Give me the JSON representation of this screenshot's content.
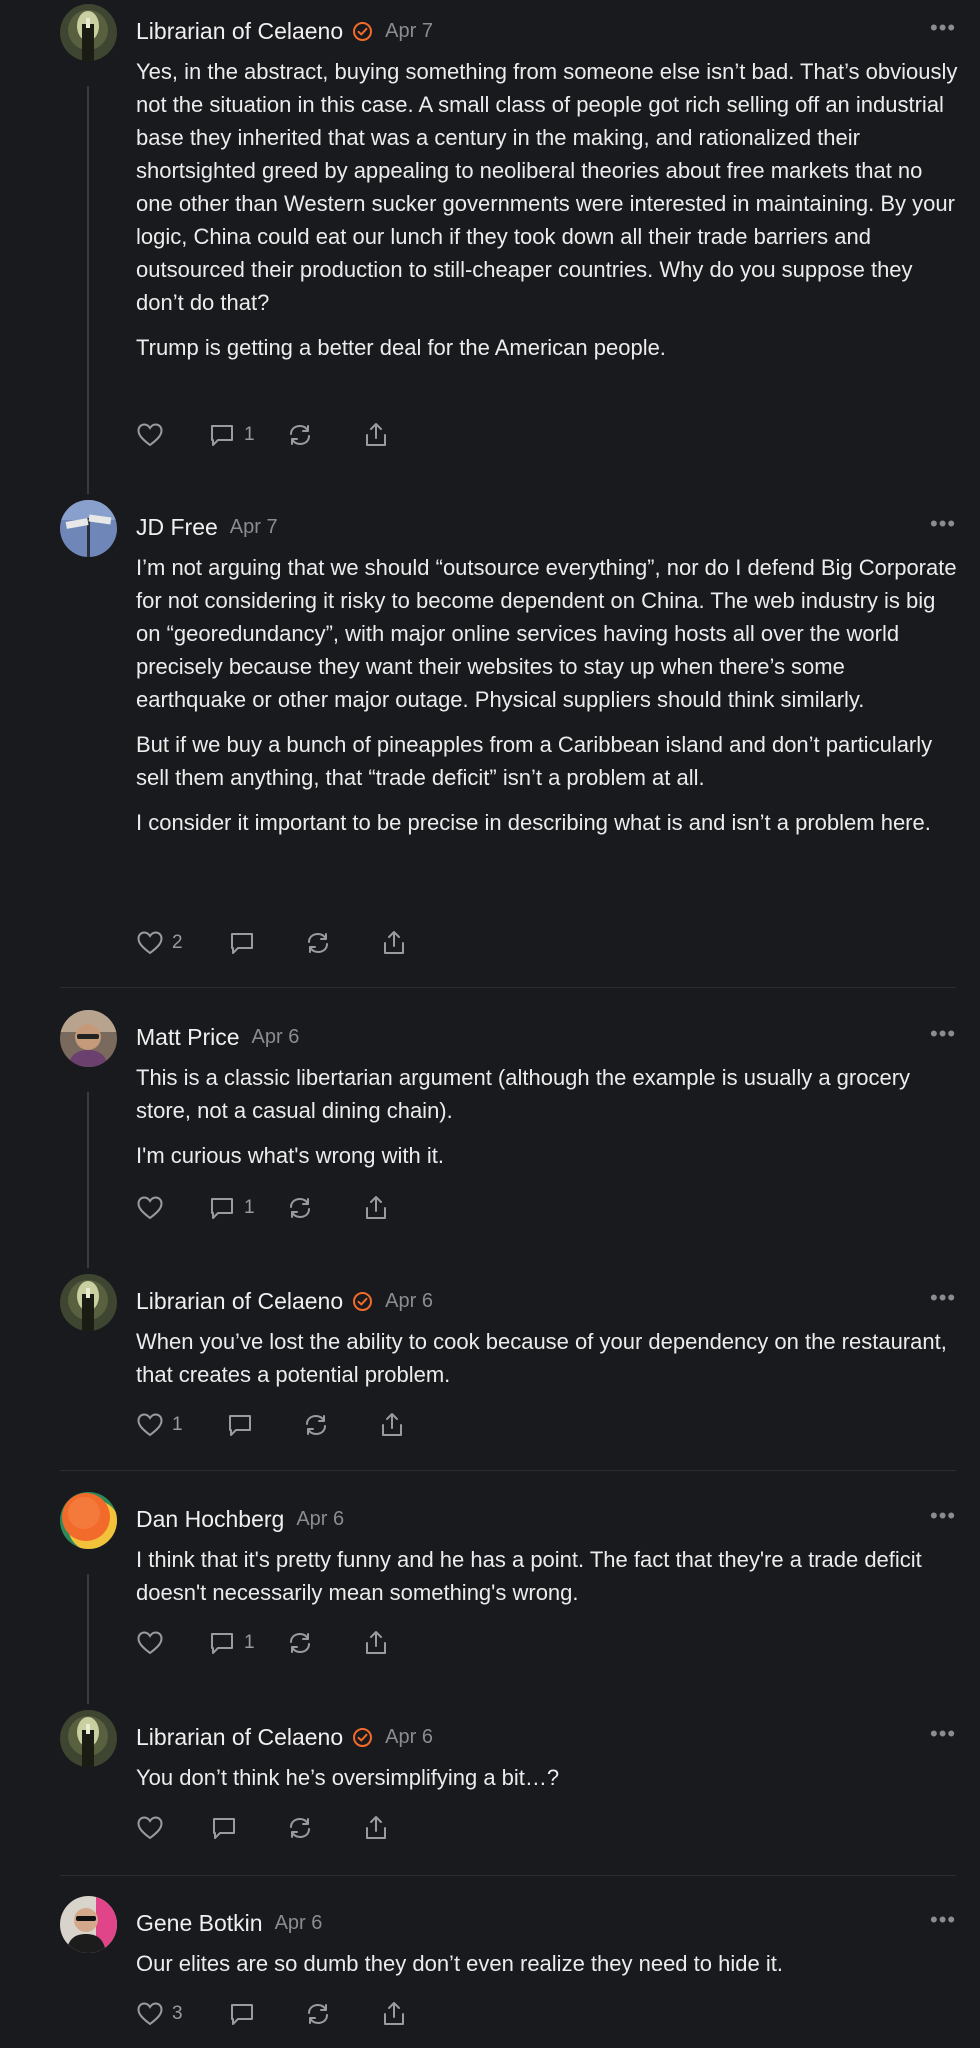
{
  "comments": [
    {
      "author": "Librarian of Celaeno",
      "verified": true,
      "date": "Apr 7",
      "paragraphs": [
        "Yes, in the abstract, buying something from someone else isn’t bad. That’s obviously not the situation in this case. A small class of people got rich selling off an industrial base they inherited that was a century in the making, and rationalized their shortsighted greed by appealing to neoliberal theories about free markets that no one other than Western sucker governments were interested in maintaining. By your logic, China could eat our lunch if they took down all their trade barriers and outsourced their production to still-cheaper countries. Why do you suppose they don’t do that?",
        "Trump is getting a better deal for the American people."
      ],
      "likes": "",
      "replies": "1"
    },
    {
      "author": "JD Free",
      "verified": false,
      "date": "Apr 7",
      "paragraphs": [
        "I’m not arguing that we should “outsource everything”, nor do I defend Big Corporate for not considering it risky to become dependent on China. The web industry is big on “georedundancy”, with major online services having hosts all over the world precisely because they want their websites to stay up when there’s some earthquake or other major outage. Physical suppliers should think similarly.",
        "But if we buy a bunch of pineapples from a Caribbean island and don’t particularly sell them anything, that “trade deficit” isn’t a problem at all.",
        "I consider it important to be precise in describing what is and isn’t a problem here."
      ],
      "likes": "2",
      "replies": ""
    },
    {
      "author": "Matt Price",
      "verified": false,
      "date": "Apr 6",
      "paragraphs": [
        "This is a classic libertarian argument (although the example is usually a grocery store, not a casual dining chain).",
        "I'm curious what's wrong with it."
      ],
      "likes": "",
      "replies": "1"
    },
    {
      "author": "Librarian of Celaeno",
      "verified": true,
      "date": "Apr 6",
      "paragraphs": [
        "When you’ve lost the ability to cook because of your dependency on the restaurant, that creates a potential problem."
      ],
      "likes": "1",
      "replies": ""
    },
    {
      "author": "Dan Hochberg",
      "verified": false,
      "date": "Apr 6",
      "paragraphs": [
        "I think that it's pretty funny and he has a point. The fact that they're a trade deficit doesn't necessarily mean something's wrong."
      ],
      "likes": "",
      "replies": "1"
    },
    {
      "author": "Librarian of Celaeno",
      "verified": true,
      "date": "Apr 6",
      "paragraphs": [
        "You don’t think he’s oversimplifying a bit…?"
      ],
      "likes": "",
      "replies": ""
    },
    {
      "author": "Gene Botkin",
      "verified": false,
      "date": "Apr 6",
      "paragraphs": [
        "Our elites are so dumb they don’t even realize they need to hide it."
      ],
      "likes": "3",
      "replies": ""
    }
  ],
  "icons": {
    "like": "heart-icon",
    "reply": "comment-icon",
    "restack": "restack-icon",
    "share": "share-icon",
    "more": "more-options-icon",
    "verified": "verified-badge-icon"
  },
  "colors": {
    "background": "#191a1d",
    "verified": "#f26b2a",
    "muted": "#8b8c90"
  }
}
